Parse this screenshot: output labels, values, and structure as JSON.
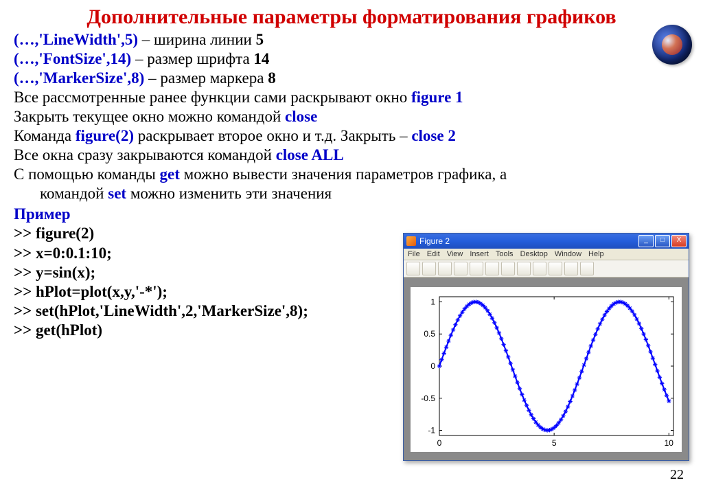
{
  "title": "Дополнительные параметры форматирования графиков",
  "lines": {
    "l1a": "(…,'LineWidth',5)",
    "l1b": " – ширина линии   ",
    "l1c": "5",
    "l2a": "(…,'FontSize',14)",
    "l2b": " – размер шрифта ",
    "l2c": "14",
    "l3a": "(…,'MarkerSize',8)",
    "l3b": " – размер маркера ",
    "l3c": "8",
    "l4a": "Все рассмотренные ранее функции сами раскрывают окно ",
    "l4b": "figure 1",
    "l5a": "Закрыть текущее окно можно командой  ",
    "l5b": "close",
    "l6a": "Команда ",
    "l6b": "figure(2)",
    "l6c": " раскрывает второе окно и т.д. Закрыть – ",
    "l6d": "close 2",
    "l7a": "Все окна сразу закрываются командой ",
    "l7b": "close ALL",
    "l8a": "С помощью команды ",
    "l8b": "get",
    "l8c": " можно вывести значения параметров графика, а",
    "l8d": "командой ",
    "l8e": "set",
    "l8f": " можно изменить эти значения"
  },
  "example_label": "Пример",
  "code": {
    "c1": ">> figure(2)",
    "c2": ">> x=0:0.1:10;",
    "c3": ">> y=sin(x);",
    "c4": ">> hPlot=plot(x,y,'-*');",
    "c5": ">> set(hPlot,'LineWidth',2,'MarkerSize',8);",
    "c6": ">> get(hPlot)"
  },
  "pageNumber": "22",
  "figureWindow": {
    "title": "Figure 2",
    "menu": [
      "File",
      "Edit",
      "View",
      "Insert",
      "Tools",
      "Desktop",
      "Window",
      "Help"
    ],
    "winButtons": {
      "min": "_",
      "max": "□",
      "close": "X"
    }
  },
  "chart_data": {
    "type": "line",
    "x_step": 0.1,
    "x_range": [
      0,
      10
    ],
    "function": "sin(x)",
    "marker": "*",
    "line_color": "#0000ff",
    "line_width": 2,
    "marker_size": 8,
    "xticks": [
      0,
      5,
      10
    ],
    "yticks": [
      -1,
      -0.5,
      0,
      0.5,
      1
    ],
    "xlim": [
      0,
      10.2
    ],
    "ylim": [
      -1.08,
      1.08
    ],
    "x": [
      0,
      0.1,
      0.2,
      0.3,
      0.4,
      0.5,
      0.6,
      0.7,
      0.8,
      0.9,
      1,
      1.1,
      1.2,
      1.3,
      1.4,
      1.5,
      1.6,
      1.7,
      1.8,
      1.9,
      2,
      2.1,
      2.2,
      2.3,
      2.4,
      2.5,
      2.6,
      2.7,
      2.8,
      2.9,
      3,
      3.1,
      3.2,
      3.3,
      3.4,
      3.5,
      3.6,
      3.7,
      3.8,
      3.9,
      4,
      4.1,
      4.2,
      4.3,
      4.4,
      4.5,
      4.6,
      4.7,
      4.8,
      4.9,
      5,
      5.1,
      5.2,
      5.3,
      5.4,
      5.5,
      5.6,
      5.7,
      5.8,
      5.9,
      6,
      6.1,
      6.2,
      6.3,
      6.4,
      6.5,
      6.6,
      6.7,
      6.8,
      6.9,
      7,
      7.1,
      7.2,
      7.3,
      7.4,
      7.5,
      7.6,
      7.7,
      7.8,
      7.9,
      8,
      8.1,
      8.2,
      8.3,
      8.4,
      8.5,
      8.6,
      8.7,
      8.8,
      8.9,
      9,
      9.1,
      9.2,
      9.3,
      9.4,
      9.5,
      9.6,
      9.7,
      9.8,
      9.9,
      10
    ],
    "y": [
      0,
      0.0998,
      0.1987,
      0.2955,
      0.3894,
      0.4794,
      0.5646,
      0.6442,
      0.7174,
      0.7833,
      0.8415,
      0.8912,
      0.932,
      0.9636,
      0.9854,
      0.9975,
      0.9996,
      0.9917,
      0.9738,
      0.9463,
      0.9093,
      0.8632,
      0.8085,
      0.7457,
      0.6755,
      0.5985,
      0.5155,
      0.4274,
      0.335,
      0.2392,
      0.1411,
      0.0416,
      -0.0584,
      -0.1577,
      -0.2555,
      -0.3508,
      -0.4425,
      -0.5298,
      -0.6119,
      -0.6878,
      -0.7568,
      -0.8183,
      -0.8716,
      -0.9162,
      -0.9516,
      -0.9775,
      -0.9937,
      -0.9999,
      -0.9962,
      -0.9825,
      -0.9589,
      -0.9258,
      -0.8835,
      -0.8323,
      -0.7728,
      -0.7055,
      -0.6313,
      -0.5507,
      -0.4646,
      -0.3739,
      -0.2794,
      -0.1822,
      -0.0831,
      0.0168,
      0.1165,
      0.2151,
      0.3115,
      0.4048,
      0.4941,
      0.5784,
      0.657,
      0.729,
      0.7937,
      0.8504,
      0.8987,
      0.938,
      0.9679,
      0.9882,
      0.9985,
      0.9989,
      0.9894,
      0.9699,
      0.9407,
      0.9022,
      0.8546,
      0.7985,
      0.7344,
      0.663,
      0.5849,
      0.501,
      0.4121,
      0.3191,
      0.2229,
      0.1245,
      0.0248,
      -0.0752,
      -0.1743,
      -0.2718,
      -0.3665,
      -0.4575,
      -0.544
    ]
  }
}
